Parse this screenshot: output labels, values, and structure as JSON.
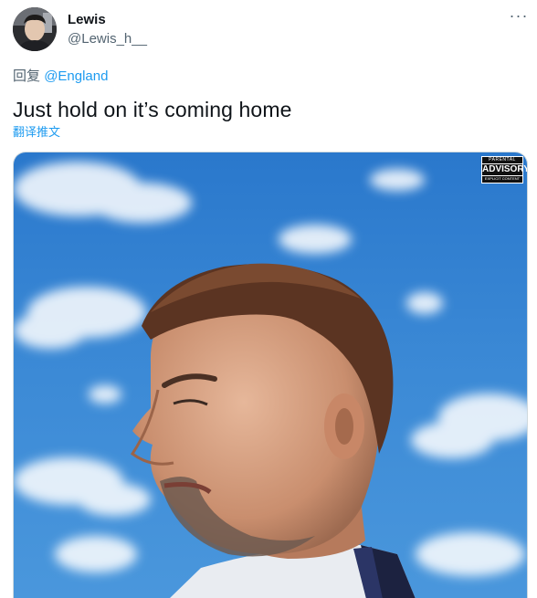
{
  "author": {
    "name": "Lewis",
    "handle": "@Lewis_h__"
  },
  "menu": {
    "more_label": "···"
  },
  "reply": {
    "prefix": "回复",
    "mention": "@England"
  },
  "tweet": {
    "text": "Just hold on it’s coming home",
    "translate_label": "翻译推文"
  },
  "media": {
    "description_icon": "photo",
    "advisory": {
      "top": "PARENTAL",
      "middle": "ADVISORY",
      "bottom": "EXPLICIT CONTENT"
    }
  },
  "colors": {
    "link": "#1d9bf0",
    "secondary_text": "#536471",
    "primary_text": "#0f1419",
    "sky": "#2f7fd0"
  }
}
